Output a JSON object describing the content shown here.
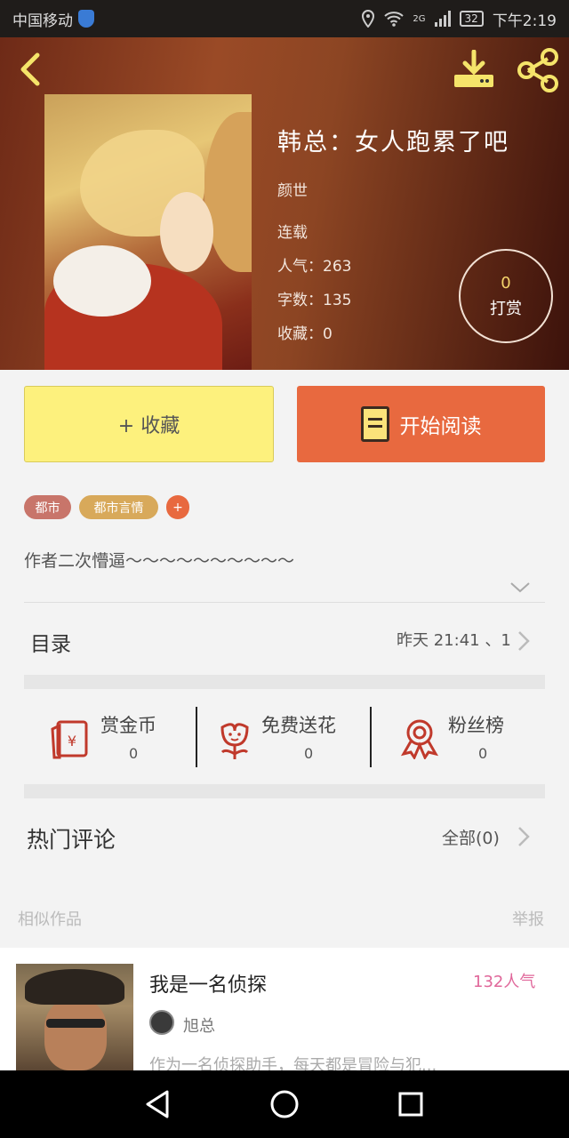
{
  "status_bar": {
    "carrier": "中国移动",
    "network": "2G",
    "battery": "32",
    "time": "下午2:19"
  },
  "book": {
    "title": "韩总：女人跑累了吧",
    "author": "颜世",
    "status": "连载",
    "popularity": "人气：263",
    "word_count": "字数：135",
    "favorites": "收藏：0",
    "description": "作者二次懵逼～～～～～～～～～～"
  },
  "tip": {
    "count": "0",
    "label": "打赏"
  },
  "actions": {
    "favorite_label": "+ 收藏",
    "read_label": "开始阅读"
  },
  "tags": [
    {
      "label": "都市",
      "color": "#c8756a"
    },
    {
      "label": "都市言情",
      "color": "#d8a95a"
    },
    {
      "label": "+",
      "color": "#e8693f"
    }
  ],
  "toc": {
    "label": "目录",
    "latest": "昨天 21:41 、1"
  },
  "stats": [
    {
      "label": "赏金币",
      "value": "0",
      "icon": "red-envelope-icon"
    },
    {
      "label": "免费送花",
      "value": "0",
      "icon": "flower-icon"
    },
    {
      "label": "粉丝榜",
      "value": "0",
      "icon": "ribbon-badge-icon"
    }
  ],
  "comments": {
    "label": "热门评论",
    "all_label": "全部(0)"
  },
  "similar": {
    "label": "相似作品",
    "report_label": "举报",
    "items": [
      {
        "title": "我是一名侦探",
        "popularity": "132人气",
        "author": "旭总",
        "description": "作为一名侦探助手，每天都是冒险与犯..."
      }
    ]
  },
  "colors": {
    "accent_orange": "#e8693f",
    "favorite_yellow": "#fdf17d",
    "icon_red": "#c0392b",
    "popularity_pink": "#e0679a"
  }
}
